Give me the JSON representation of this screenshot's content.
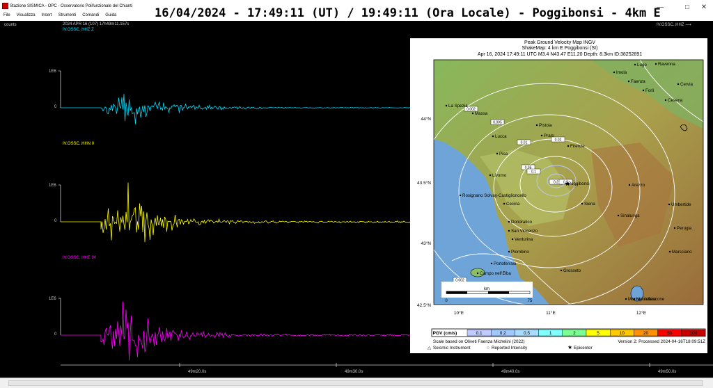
{
  "window": {
    "app_name": "Stazione SISMICA - OPC - Osservatorio Polifunzionale del Chianti",
    "title": "16/04/2024 - 17:49:11 (UT) / 19:49:11 (Ora Locale) - Poggibonsi - 4km E",
    "minimize": "—",
    "maximize": "□",
    "close": "✕"
  },
  "menu": [
    "File",
    "Visualizza",
    "Insert",
    "Strumenti",
    "Comandi",
    "Guida"
  ],
  "plot": {
    "counts_label": "counts",
    "time_header": "2024 APR 16 (107)  17h49m11.157s",
    "station_right": "IV.OSSC..HHZ  ⟶",
    "traces": [
      {
        "label": "IV.OSSC..HHZ  Z",
        "color": "#00e0ff",
        "scale": "1E6",
        "zero": "0"
      },
      {
        "label": "IV.OSSC..HHN  0",
        "color": "#ffff00",
        "scale": "1E6",
        "zero": "0"
      },
      {
        "label": "IV.OSSC..HHE  90",
        "color": "#ff00ff",
        "scale": "1E6",
        "zero": "0"
      }
    ],
    "time_ticks": [
      "49m20.0s",
      "49m30.0s",
      "49m40.0s",
      "49m50.0s"
    ]
  },
  "map": {
    "title": "Peak Ground Velocity Map INGV",
    "subtitle": "ShakeMap: 4 km E Poggibonsi (SI)",
    "event": "Apr 16, 2024 17:49:11 UTC M3.4 N43.47 E11.20 Depth: 8.3km ID:38252891",
    "lat_ticks": [
      "44°N",
      "43.5°N",
      "43°N",
      "42.5°N"
    ],
    "lon_ticks": [
      "10°E",
      "11°E",
      "12°E"
    ],
    "scale_label": "km",
    "scale_min": "0",
    "scale_max": "75",
    "cities": [
      "La Spezia",
      "Massa",
      "Lucca",
      "Pisa",
      "Prato",
      "Pistoia",
      "Firenze",
      "Livorno",
      "Poggibonsi",
      "Rosignano Solvay-Castiglioncello",
      "Cecina",
      "Siena",
      "Arezzo",
      "Donoratico",
      "San Vincenzo",
      "Venturina",
      "Piombino",
      "Portoferraio",
      "Campo nell'Elba",
      "Grosseto",
      "Sinalunga",
      "Montepulciano",
      "Umbertide",
      "Perugia",
      "Marsciano",
      "Montefiascone",
      "Imola",
      "Lugo",
      "Ravenna",
      "Faenza",
      "Forlì",
      "Cervia",
      "Cesena"
    ],
    "contour_labels": [
      "0.002",
      "0.005",
      "0.01",
      "0.02",
      "0.05",
      "0.1",
      "0.2",
      "0.5",
      "0.002"
    ],
    "legend_title": "PGV (cm/s)",
    "legend_values": [
      "0.1",
      "0.2",
      "0.5",
      "1",
      "2",
      "5",
      "10",
      "20",
      "50",
      "100"
    ],
    "legend_colors": [
      "#bfcbff",
      "#a0c8ff",
      "#a6dcff",
      "#80ffff",
      "#7aff93",
      "#ffff00",
      "#ffc800",
      "#ff9100",
      "#ff0000",
      "#c80000"
    ],
    "footer_left": "Scale based on Oliveti Faenza Michelini (2022)",
    "footer_right": "Version 2: Processed 2024-04-16T18:09:51Z",
    "key_instrument": "Seismic Instrument",
    "key_reported": "Reported Intensity",
    "key_epicenter": "Epicenter"
  }
}
